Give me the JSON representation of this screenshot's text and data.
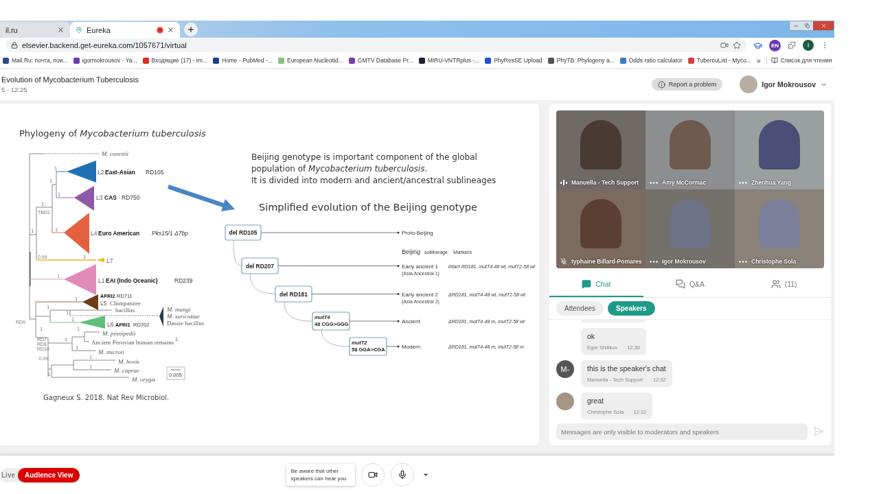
{
  "browser": {
    "tabs": [
      {
        "title": "il.ru",
        "selected": false,
        "recording": false
      },
      {
        "title": "Eureka",
        "selected": true,
        "recording": true
      }
    ],
    "url": "elsevier.backend.get-eureka.com/1057671/virtual",
    "language_badge": "EN",
    "profile_initial": "I",
    "bookmarks": [
      "Mail.Ru: почта, пои...",
      "igormokrousov - Ya...",
      "Входящие (17) - im...",
      "Home - PubMed -...",
      "European Nucleotid...",
      "GMTV Database Pr...",
      "MIRU-VNTRplus -...",
      "PhyResSE Upload",
      "PhyTB: Phylogeny a...",
      "Odds ratio calculator",
      "TubercuList - Myco..."
    ],
    "bookmarks_more": "»",
    "reading_list": "Список для чтения"
  },
  "header": {
    "title": "Evolution of Mycobacterium Tuberculosis",
    "time": "5 - 12:25",
    "report_button": "Report a problem",
    "user": "Igor Mokrousov"
  },
  "slide": {
    "tree_title": "Phylogeny of *Mycobacterium tuberculosis*",
    "tree_labels": [
      {
        "text": "M. canettii",
        "kind": "species"
      },
      {
        "text": "L2",
        "kind": "plain"
      },
      {
        "text": "East-Asian",
        "kind": "clade"
      },
      {
        "text": "RD105",
        "kind": "marker"
      },
      {
        "text": "L3",
        "kind": "plain"
      },
      {
        "text": "CAS",
        "kind": "clade"
      },
      {
        "text": "RD750",
        "kind": "marker"
      },
      {
        "text": "L4",
        "kind": "plain"
      },
      {
        "text": "Euro American",
        "kind": "clade"
      },
      {
        "text": "Pks15/1 Δ7bp",
        "kind": "marker_italic"
      },
      {
        "text": "L7",
        "kind": "plain"
      },
      {
        "text": "L1",
        "kind": "plain"
      },
      {
        "text": "EAI (Indo Oceanic)",
        "kind": "clade"
      },
      {
        "text": "RD239",
        "kind": "marker"
      },
      {
        "text": "AFRI2",
        "kind": "clade_small"
      },
      {
        "text": "RD711",
        "kind": "marker_small"
      },
      {
        "text": "L5",
        "kind": "plain"
      },
      {
        "text": "Chimpanzee",
        "kind": "common"
      },
      {
        "text": "bacillus",
        "kind": "common"
      },
      {
        "text": "M. mungi",
        "kind": "species"
      },
      {
        "text": "M. suricattae",
        "kind": "species"
      },
      {
        "text": "L6",
        "kind": "plain"
      },
      {
        "text": "AFRI1",
        "kind": "clade_small"
      },
      {
        "text": "RD702",
        "kind": "marker_small"
      },
      {
        "text": "Dassie bacillus",
        "kind": "common"
      },
      {
        "text": "M. pinnipedii",
        "kind": "species"
      },
      {
        "text": "Ancient Peruvian human remains",
        "kind": "common"
      },
      {
        "text": "1",
        "kind": "footnote"
      },
      {
        "text": "M. microti",
        "kind": "species"
      },
      {
        "text": "M. bovis",
        "kind": "species"
      },
      {
        "text": "M. caprae",
        "kind": "species"
      },
      {
        "text": "M. orygis",
        "kind": "species"
      },
      {
        "text": "0.005",
        "kind": "scale"
      }
    ],
    "support_values": [
      "1",
      "1",
      "1",
      "1",
      "1",
      "1",
      "1",
      "1",
      "1",
      "1",
      "1",
      "1",
      "1",
      "1",
      "1",
      "1",
      "1",
      "1",
      "1"
    ],
    "node_labels": [
      "TBD1",
      "0.99",
      "RD9",
      "RD7",
      "RD8",
      "RD10",
      "0.99"
    ],
    "citation": "Gagneux S. 2018. Nat Rev Microbiol.",
    "intro_lines": [
      "Beijing genotype is important component of the global",
      "population of *Mycobacterium tuberculosis*.",
      "It is divided into modern and ancient/ancestral sublineages"
    ],
    "diagram_title": "Simplified evolution of the Beijing genotype",
    "diagram": {
      "nodes": [
        {
          "kind": "deletion",
          "label": "del RD105"
        },
        {
          "kind": "deletion",
          "label": "del RD207"
        },
        {
          "kind": "deletion",
          "label": "del RD181"
        },
        {
          "kind": "mutation",
          "gene": "mutT4",
          "change": "48 CGG>GGG"
        },
        {
          "kind": "mutation",
          "gene": "mutT2",
          "change": "58 GGA>CGA"
        }
      ],
      "header_labels": [
        "Beijing",
        "sublineage",
        "Markers"
      ],
      "branches": [
        {
          "name": "Proto-Beijing"
        },
        {
          "name": "Early ancient 1",
          "note": "(Asia Ancestral 1)",
          "markers": "intact RD181, mutT4-48 wt, mutT2-58 wt"
        },
        {
          "name": "Early ancient 2",
          "note": "(Asia Ancestral 2)",
          "markers": "ΔRD181, mutT4-48 wt, mutT2-58 wt"
        },
        {
          "name": "Ancient",
          "markers": "ΔRD181, mutT4-48 m, mutT2-58 wt"
        },
        {
          "name": "Modern",
          "markers": "ΔRD181, mutT4-48 m, mutT2-58 m"
        }
      ]
    }
  },
  "video": {
    "tiles": [
      {
        "name": "Manuella - Tech Support",
        "kind": "speaking"
      },
      {
        "name": "Amy McCormac",
        "kind": "idle"
      },
      {
        "name": "Zhenhua Yang",
        "kind": "idle"
      },
      {
        "name": "typhaine Billard-Pomares",
        "kind": "muted"
      },
      {
        "name": "Igor Mokrousov",
        "kind": "idle"
      },
      {
        "name": "Christophe Sola",
        "kind": "idle"
      }
    ]
  },
  "panel_tabs": [
    {
      "label": "Chat",
      "selected": true
    },
    {
      "label": "Q&A",
      "selected": false
    },
    {
      "label": "(11)",
      "selected": false
    }
  ],
  "chat_filters": [
    {
      "label": "Attendees",
      "selected": false
    },
    {
      "label": "Speakers",
      "selected": true
    }
  ],
  "chat": {
    "partial_message_above": true,
    "messages": [
      {
        "text": "ok",
        "author": "Egor Shitikov",
        "time": "12:30",
        "kind": "continued"
      },
      {
        "text": "this is the speaker's chat",
        "author": "Manuella - Tech Support",
        "time": "12:32",
        "kind": "initials",
        "initials": "M-"
      },
      {
        "text": "great",
        "author": "Christophe Sola",
        "time": "12:32",
        "kind": "photo"
      }
    ],
    "placeholder": "Messages are only visible to moderators and speakers"
  },
  "footer": {
    "modes": [
      {
        "label": "Live",
        "selected": false
      },
      {
        "label": "Audience View",
        "selected": true
      }
    ],
    "notice": "Be aware that other speakers can hear you"
  }
}
